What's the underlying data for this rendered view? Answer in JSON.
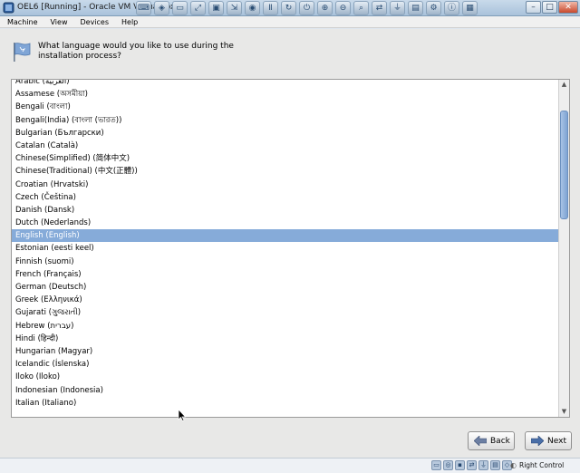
{
  "window": {
    "title": "OEL6 [Running] - Oracle VM VirtualBox",
    "buttons": {
      "minimize": "–",
      "maximize": "□",
      "close": "✕"
    }
  },
  "menubar": {
    "items": [
      {
        "label": "Machine"
      },
      {
        "label": "View"
      },
      {
        "label": "Devices"
      },
      {
        "label": "Help"
      }
    ]
  },
  "installer": {
    "prompt_line1": "What language would you like to use during the",
    "prompt_line2": "installation process?",
    "languages": [
      "Arabic (العربية)",
      "Assamese (অসমীয়া)",
      "Bengali (বাংলা)",
      "Bengali(India) (বাংলা (ভারত))",
      "Bulgarian (Български)",
      "Catalan (Català)",
      "Chinese(Simplified) (简体中文)",
      "Chinese(Traditional) (中文(正體))",
      "Croatian (Hrvatski)",
      "Czech (Čeština)",
      "Danish (Dansk)",
      "Dutch (Nederlands)",
      "English (English)",
      "Estonian (eesti keel)",
      "Finnish (suomi)",
      "French (Français)",
      "German (Deutsch)",
      "Greek (Ελληνικά)",
      "Gujarati (ગુજરાતી)",
      "Hebrew (עברית)",
      "Hindi (हिन्दी)",
      "Hungarian (Magyar)",
      "Icelandic (Íslenska)",
      "Iloko (Iloko)",
      "Indonesian (Indonesia)",
      "Italian (Italiano)"
    ],
    "selected_language": "English (English)",
    "back_label": "Back",
    "next_label": "Next"
  },
  "statusbar": {
    "host_key": "Right Control"
  },
  "colors": {
    "selection": "#86abd9",
    "window_chrome": "#a9c2db"
  }
}
